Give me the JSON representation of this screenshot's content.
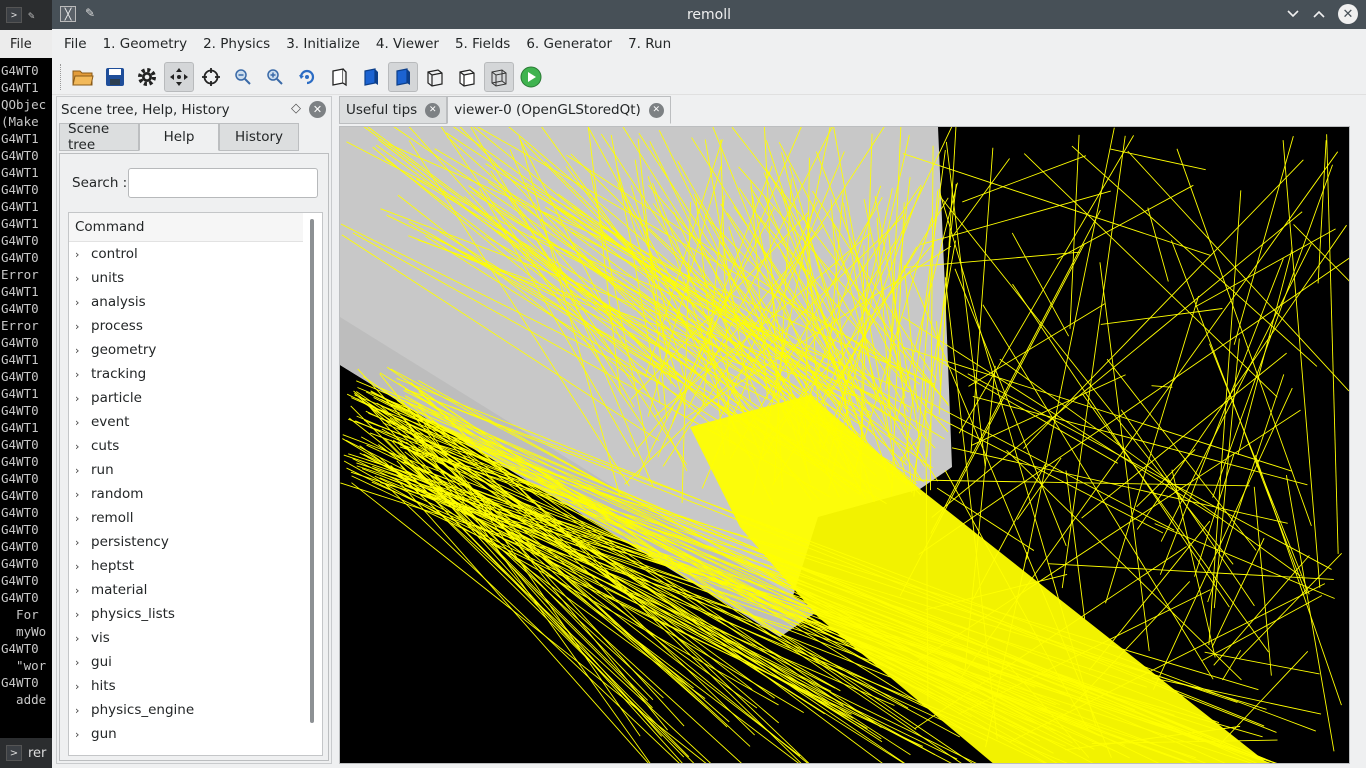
{
  "terminal": {
    "menu_file": "File",
    "lines": [
      "G4WT0",
      "G4WT1",
      "QObjec",
      "(Make",
      "G4WT1",
      "G4WT0",
      "G4WT1",
      "G4WT0",
      "G4WT1",
      "G4WT1",
      "G4WT0",
      "G4WT0",
      "Error",
      "G4WT1",
      "G4WT0",
      "Error",
      "G4WT0",
      "G4WT1",
      "G4WT0",
      "G4WT1",
      "G4WT0",
      "G4WT1",
      "G4WT0",
      "G4WT0",
      "G4WT0",
      "G4WT0",
      "G4WT0",
      "G4WT0",
      "G4WT0",
      "G4WT0",
      "G4WT0",
      "G4WT0",
      "  For",
      "  myWo",
      "G4WT0",
      "  \"wor",
      "G4WT0",
      "  adde"
    ],
    "taskbar_label": "rer"
  },
  "window": {
    "title": "remoll",
    "icon": "app-icon",
    "controls": [
      "minimize-icon",
      "maximize-icon",
      "close-icon"
    ]
  },
  "menubar": {
    "items": [
      "File",
      "1. Geometry",
      "2. Physics",
      "3. Initialize",
      "4. Viewer",
      "5. Fields",
      "6. Generator",
      "7. Run"
    ]
  },
  "toolbar": {
    "icons": [
      "open-folder-icon",
      "save-icon",
      "settings-gear-icon",
      "move-icon",
      "pick-target-icon",
      "zoom-out-icon",
      "zoom-in-icon",
      "rotate-icon",
      "hidden-line-icon",
      "solid-icon",
      "solid-active-icon",
      "wireframe-icon",
      "hidden-line-removal-icon",
      "perspective-icon",
      "run-beam-icon"
    ]
  },
  "dock": {
    "title": "Scene tree, Help, History",
    "tabs": [
      "Scene tree",
      "Help",
      "History"
    ],
    "active_tab": "Help",
    "search_label": "Search :",
    "search_value": "",
    "tree_header": "Command",
    "commands": [
      "control",
      "units",
      "analysis",
      "process",
      "geometry",
      "tracking",
      "particle",
      "event",
      "cuts",
      "run",
      "random",
      "remoll",
      "persistency",
      "heptst",
      "material",
      "physics_lists",
      "vis",
      "gui",
      "hits",
      "physics_engine",
      "gun"
    ]
  },
  "viewer_tabs": {
    "tabs": [
      "Useful tips",
      "viewer-0 (OpenGLStoredQt)"
    ],
    "active": "viewer-0 (OpenGLStoredQt)"
  },
  "colors": {
    "track": "#ffff00",
    "geometry": "#c8c8c8",
    "background": "#000000",
    "titlebar": "#475057"
  }
}
